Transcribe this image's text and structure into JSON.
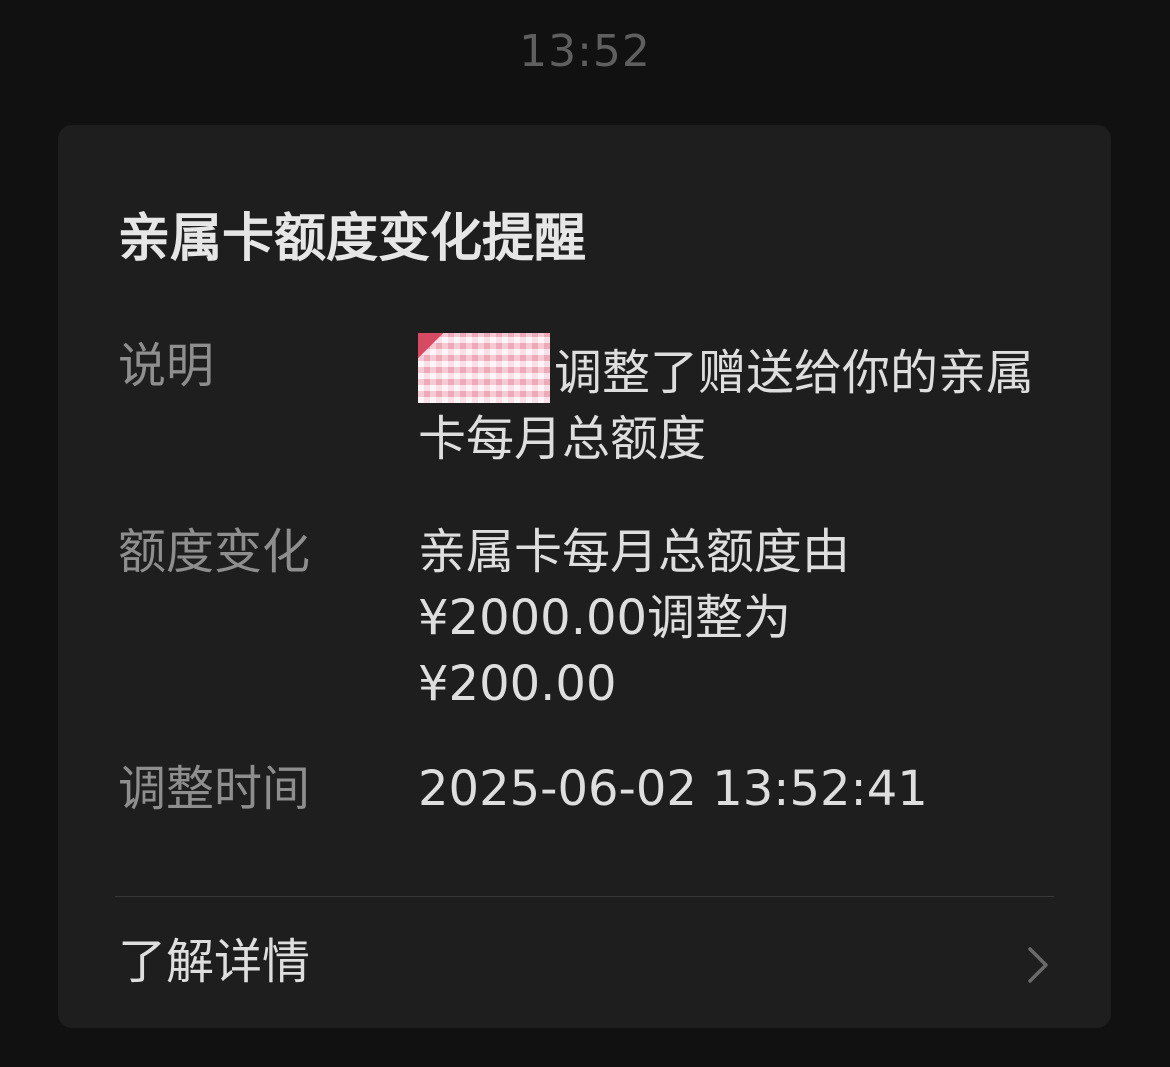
{
  "status_time": "13:52",
  "card": {
    "title": "亲属卡额度变化提醒",
    "rows": [
      {
        "label": "说明",
        "redacted_name_icon": "redacted-sender-name",
        "value": "调整了赠送给你的亲属卡每月总额度"
      },
      {
        "label": "额度变化",
        "value_line1": "亲属卡每月总额度由",
        "value_line2": "¥2000.00调整为",
        "value_line3": "¥200.00"
      },
      {
        "label": "调整时间",
        "value": "2025-06-02 13:52:41"
      }
    ],
    "details_label": "了解详情",
    "details_icon": "chevron-right-icon"
  },
  "colors": {
    "background": "#111111",
    "card": "#1e1e1e",
    "label": "#8e8e8e",
    "value": "#dedede"
  }
}
